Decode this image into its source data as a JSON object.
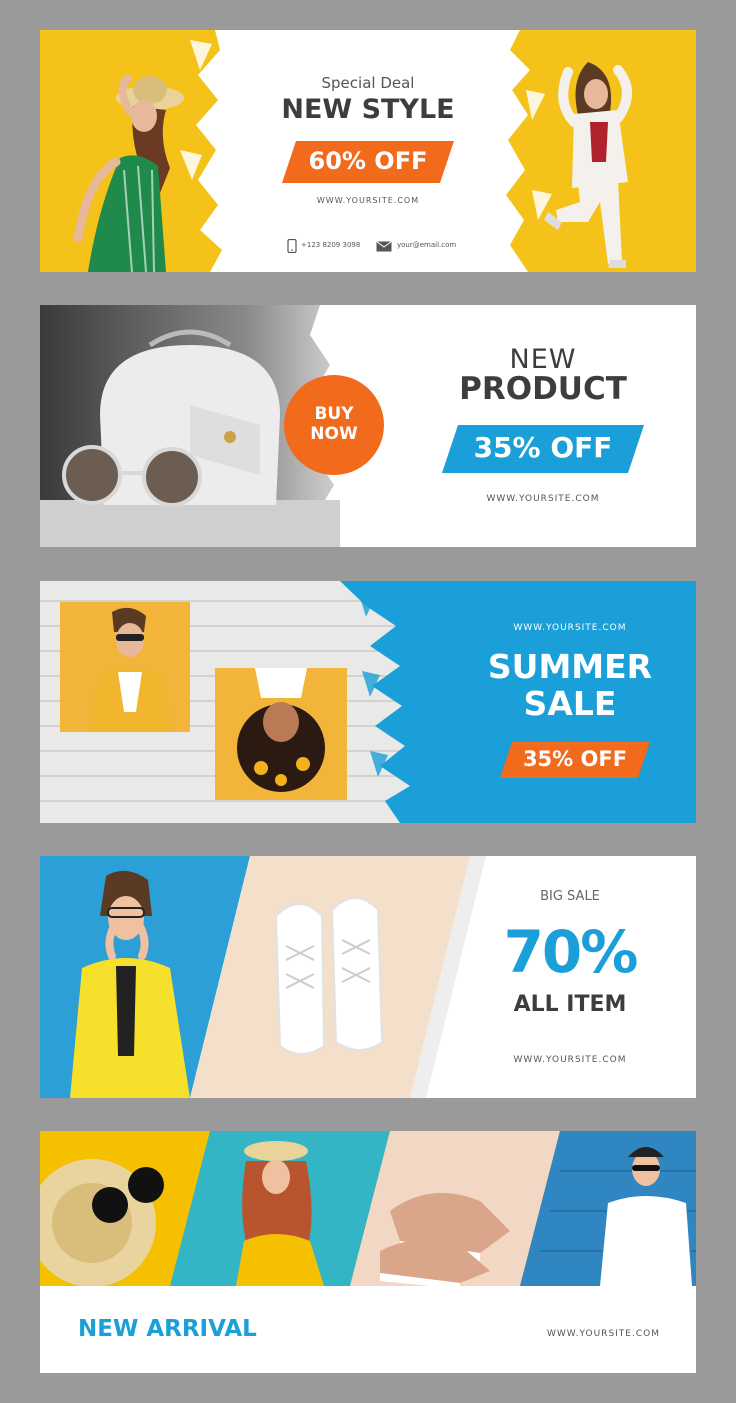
{
  "colors": {
    "yellow": "#f5c21a",
    "orange": "#f26a1b",
    "blue": "#1a9fd8",
    "dark_text": "#3d3d3d",
    "gray_text": "#666666",
    "page_bg": "#9a9a9a"
  },
  "banner1": {
    "kicker": "Special Deal",
    "headline": "NEW STYLE",
    "badge": "60% OFF",
    "site": "WWW.YOURSITE.COM",
    "phone": "+123 8209 3098",
    "email": "your@email.com",
    "phone_icon": "phone-icon",
    "email_icon": "envelope-icon"
  },
  "banner2": {
    "cta_line1": "BUY",
    "cta_line2": "NOW",
    "line1": "NEW",
    "line2": "PRODUCT",
    "badge": "35% OFF",
    "site": "WWW.YOURSITE.COM"
  },
  "banner3": {
    "site": "WWW.YOURSITE.COM",
    "line1": "SUMMER",
    "line2": "SALE",
    "badge": "35% OFF"
  },
  "banner4": {
    "kicker": "BIG SALE",
    "value": "70%",
    "line": "ALL ITEM",
    "site": "WWW.YOURSITE.COM"
  },
  "banner5": {
    "headline": "NEW ARRIVAL",
    "site": "WWW.YOURSITE.COM"
  }
}
